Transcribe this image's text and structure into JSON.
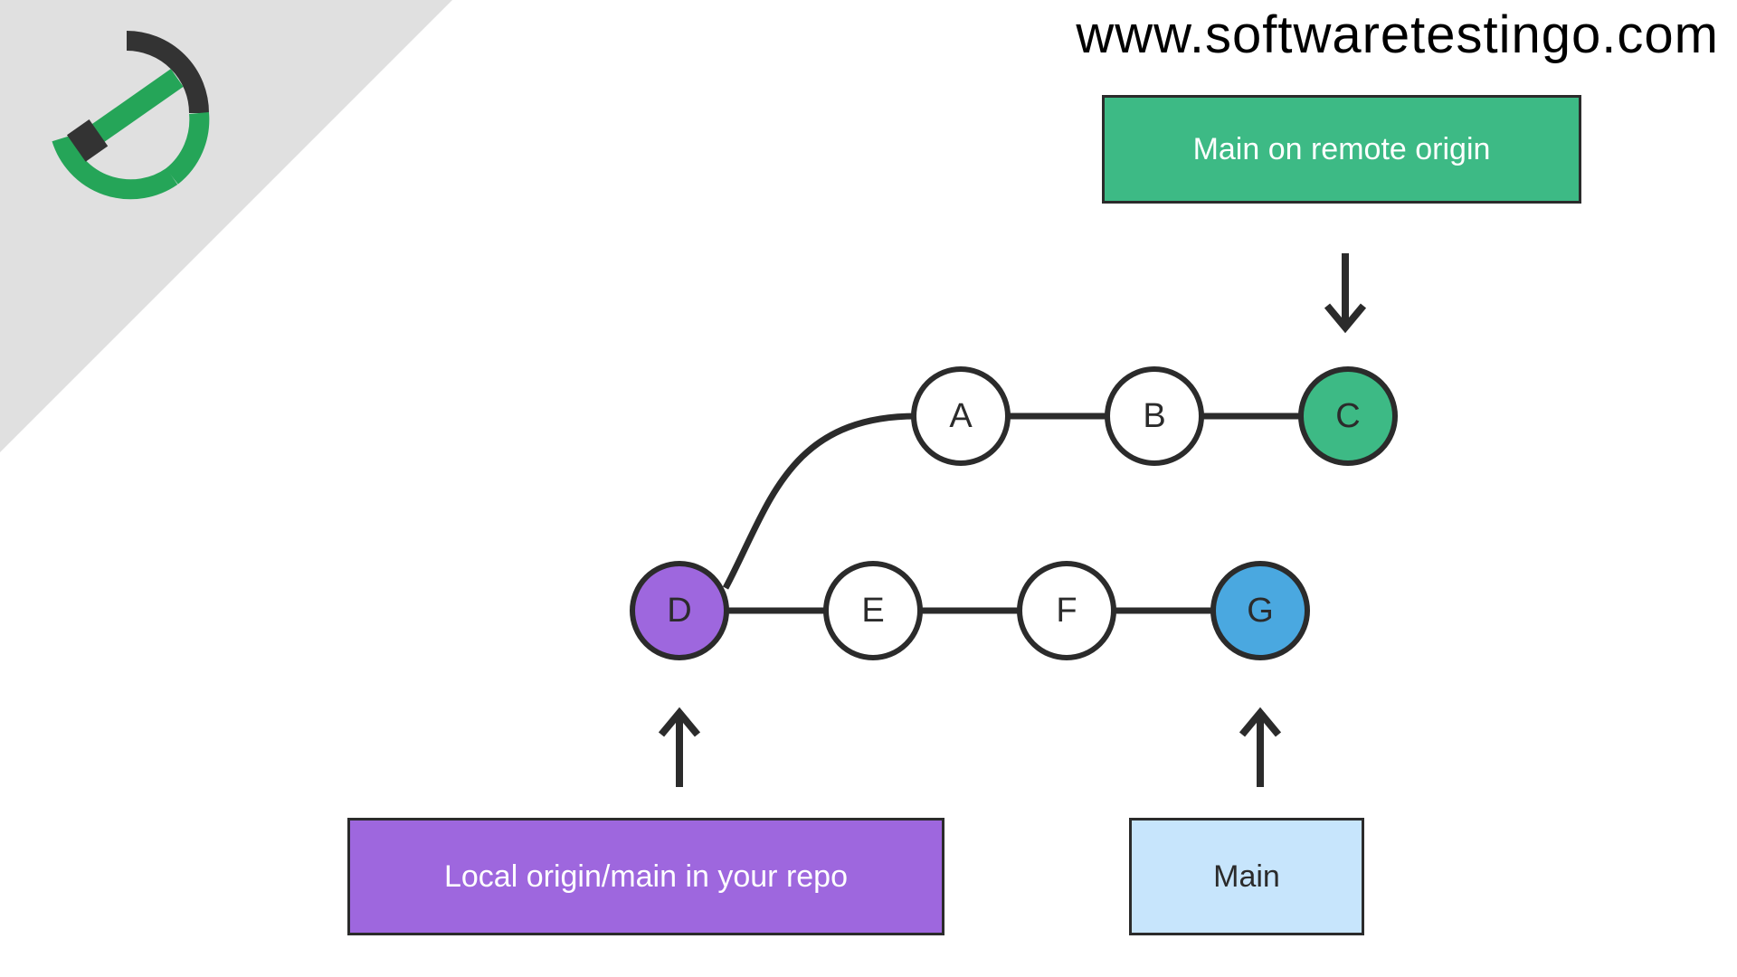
{
  "site_url": "www.softwaretestingo.com",
  "boxes": {
    "remote": "Main on remote origin",
    "local": "Local origin/main in your repo",
    "main": "Main"
  },
  "nodes": {
    "a": "A",
    "b": "B",
    "c": "C",
    "d": "D",
    "e": "E",
    "f": "F",
    "g": "G"
  },
  "colors": {
    "green": "#3DBA85",
    "purple": "#9E67DE",
    "blue": "#4AA8E0",
    "lightblue": "#c7e5fc",
    "grey": "#e0e0e0",
    "stroke": "#2b2b2b"
  }
}
